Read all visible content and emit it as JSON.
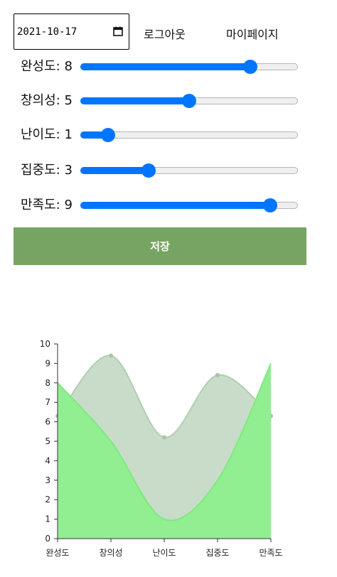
{
  "header": {
    "date_value": "2021-10-17",
    "logout_label": "로그아웃",
    "mypage_label": "마이페이지"
  },
  "sliders": [
    {
      "label": "완성도",
      "value": 8,
      "display": "완성도: 8"
    },
    {
      "label": "창의성",
      "value": 5,
      "display": "창의성: 5"
    },
    {
      "label": "난이도",
      "value": 1,
      "display": "난이도: 1"
    },
    {
      "label": "집중도",
      "value": 3,
      "display": "집중도: 3"
    },
    {
      "label": "만족도",
      "value": 9,
      "display": "만족도: 9"
    }
  ],
  "slider_range": [
    0,
    10
  ],
  "save_label": "저장",
  "colors": {
    "accent": "#0075ff",
    "save_button": "#77a463",
    "series_current": "#90ee90",
    "series_other": "#c9dcc9"
  },
  "chart_data": {
    "type": "area",
    "categories": [
      "완성도",
      "창의성",
      "난이도",
      "집중도",
      "만족도"
    ],
    "yticks": [
      "0",
      "1",
      "2",
      "3",
      "4",
      "5",
      "6",
      "7",
      "8",
      "9",
      "10"
    ],
    "ylim": [
      0,
      10
    ],
    "series": [
      {
        "values": [
          6.3,
          9.4,
          5.2,
          8.4,
          6.3
        ],
        "color": "#c9dcc9",
        "markers": true
      },
      {
        "values": [
          8,
          5,
          1,
          3,
          9
        ],
        "color": "#90ee90",
        "markers": false
      }
    ]
  }
}
